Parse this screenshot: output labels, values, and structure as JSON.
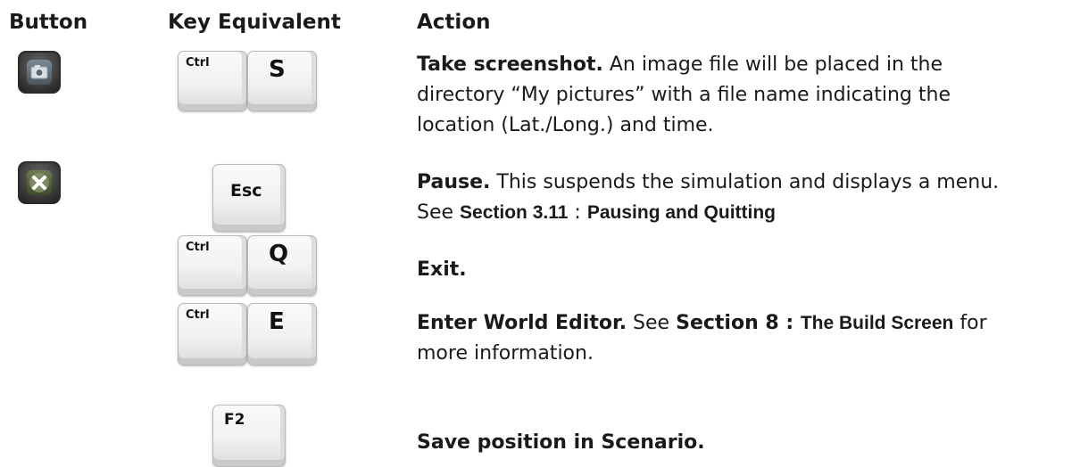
{
  "headers": {
    "button": "Button",
    "key_equivalent": "Key Equivalent",
    "action": "Action"
  },
  "rows": [
    {
      "icon": "camera-icon",
      "keys": [
        "Ctrl",
        "S"
      ],
      "title": "Take screenshot.",
      "text1": " An image file will be placed in the",
      "text2": "directory “My pictures” with a file name indicating the",
      "text3": "location (Lat./Long.) and time."
    },
    {
      "icon": "close-icon",
      "keys": [
        "Esc"
      ],
      "title": "Pause.",
      "text1": " This suspends the simulation and displays a menu.",
      "see": "See ",
      "ref_section": "Section 3.11",
      "sep": " : ",
      "ref_title": "Pausing and Quitting"
    },
    {
      "keys": [
        "Ctrl",
        "Q"
      ],
      "title": "Exit."
    },
    {
      "keys": [
        "Ctrl",
        "E"
      ],
      "title": "Enter World Editor.",
      "see": " See ",
      "ref_section": "Section 8",
      "sep": " : ",
      "ref_title": "The Build Screen",
      "text_after": " for",
      "text2": "more information."
    },
    {
      "keys": [
        "F2"
      ],
      "title": "Save position in Scenario."
    }
  ]
}
